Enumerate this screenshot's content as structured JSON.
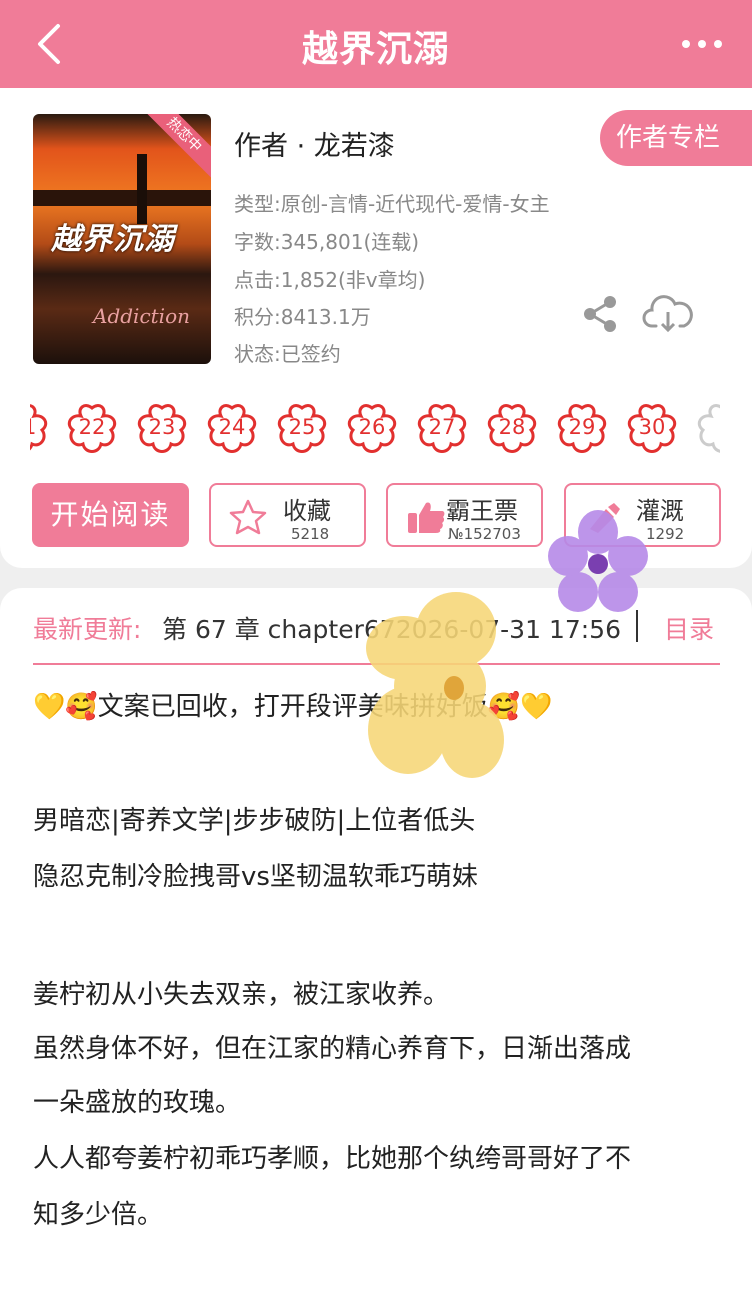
{
  "header": {
    "title": "越界沉溺",
    "back_icon": "chevron-left-icon",
    "more_icon": "ellipsis-icon"
  },
  "book": {
    "cover": {
      "ribbon": "热恋中",
      "title": "越界沉溺",
      "subtitle": "Addiction"
    },
    "author_line": "作者 · 龙若漆",
    "author_column_button": "作者专栏",
    "meta": [
      "类型:原创-言情-近代现代-爱情-女主",
      "字数:345,801(连载)",
      "点击:1,852(非v章均)",
      "积分:8413.1万",
      "状态:已签约"
    ],
    "share_icon": "share-icon",
    "download_icon": "cloud-download-icon"
  },
  "flowers": [
    "22",
    "23",
    "24",
    "25",
    "26",
    "27",
    "28",
    "29",
    "30"
  ],
  "actions": {
    "read": "开始阅读",
    "favorite": {
      "label": "收藏",
      "count": "5218",
      "icon": "star-icon"
    },
    "ticket": {
      "label": "霸王票",
      "count": "№152703",
      "icon": "thumbs-up-icon"
    },
    "water": {
      "label": "灌溉",
      "count": "1292",
      "icon": "watering-bottle-icon"
    }
  },
  "latest": {
    "label": "最新更新:",
    "text": "第 67 章 chapter672026-07-31 17:56",
    "toc": "目录"
  },
  "description": [
    "💛🥰文案已回收，打开段评美味拼好饭🥰💛",
    "",
    "男暗恋|寄养文学|步步破防|上位者低头",
    "隐忍克制冷脸拽哥vs坚韧温软乖巧萌妹",
    "",
    "姜柠初从小失去双亲，被江家收养。",
    "虽然身体不好，但在江家的精心养育下，日渐出落成",
    "一朵盛放的玫瑰。",
    "人人都夸姜柠初乖巧孝顺，比她那个纨绔哥哥好了不",
    "知多少倍。"
  ],
  "colors": {
    "accent": "#f07c98",
    "flower_red": "#e2302f"
  }
}
